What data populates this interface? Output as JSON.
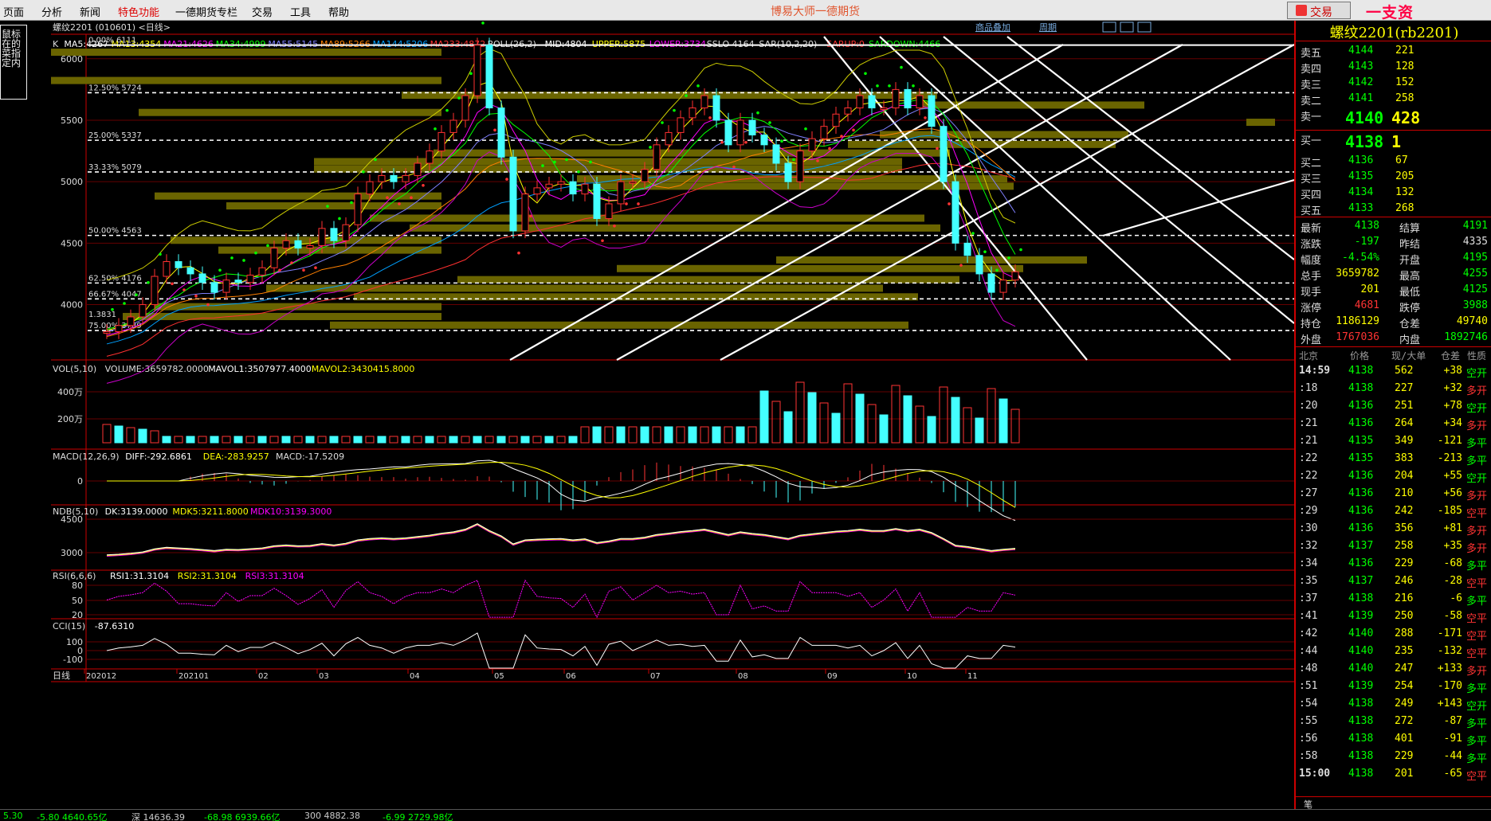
{
  "menu": {
    "items": [
      "页面",
      "分析",
      "新闻",
      "特色功能",
      "一德期货专栏",
      "交易",
      "工具",
      "帮助"
    ],
    "hot_index": 3,
    "app_title": "博易大师一德期货",
    "trade_label": "交易",
    "site_mark": "一支资5etz.com"
  },
  "tip_text": "鼠标在的菜指定内",
  "chart": {
    "header": "螺纹2201 (010601) <日线>",
    "toolbar_links": [
      "商品叠加",
      "周期"
    ],
    "main_legend": [
      {
        "text": "K",
        "color": "#dddddd"
      },
      {
        "text": "MA5:4267",
        "color": "#ffffff"
      },
      {
        "text": "MA13:4354",
        "color": "#ffff00"
      },
      {
        "text": "MA21:4626",
        "color": "#ff00ff"
      },
      {
        "text": "MA34:4999",
        "color": "#00ff00"
      },
      {
        "text": "MA55:5145",
        "color": "#8080ff"
      },
      {
        "text": "MA89:5266",
        "color": "#ff8000"
      },
      {
        "text": "MA144:5206",
        "color": "#00a0ff"
      },
      {
        "text": "MA233:4872",
        "color": "#ff3030"
      },
      {
        "text": "BOLL(26,2)",
        "color": "#dddddd"
      },
      {
        "text": "MID:4804",
        "color": "#ffffff"
      },
      {
        "text": "UPPER:5875",
        "color": "#ffff00"
      },
      {
        "text": "LOWER:3734",
        "color": "#ff00ff"
      },
      {
        "text": "SSLO 4164",
        "color": "#dddddd"
      },
      {
        "text": "SAR(10,2,20)",
        "color": "#dddddd"
      },
      {
        "text": "SARUP:0",
        "color": "#ff3030"
      },
      {
        "text": "SARDOWN:4466",
        "color": "#00ff00"
      }
    ],
    "price_ticks": [
      "6000",
      "5500",
      "5000",
      "4500",
      "4000"
    ],
    "fib_labels": [
      "0.00%  6111",
      "12.50%  5724",
      "25.00%  5337",
      "33.33%  5079",
      "50.00%  4563",
      "62.50%  4176",
      "66.67%  4047",
      "1.3831",
      "75.00%  3789"
    ],
    "vol_legend": [
      {
        "text": "VOL(5,10)",
        "color": "#dddddd"
      },
      {
        "text": "VOLUME:3659782.0000",
        "color": "#dddddd"
      },
      {
        "text": "MAVOL1:3507977.4000",
        "color": "#ffffff"
      },
      {
        "text": "MAVOL2:3430415.8000",
        "color": "#ffff00"
      }
    ],
    "vol_ticks": [
      "400万",
      "200万"
    ],
    "macd_legend": [
      {
        "text": "MACD(12,26,9)",
        "color": "#dddddd"
      },
      {
        "text": "DIFF:-292.6861",
        "color": "#ffffff"
      },
      {
        "text": "DEA:-283.9257",
        "color": "#ffff00"
      },
      {
        "text": "MACD:-17.5209",
        "color": "#dddddd"
      }
    ],
    "macd_ticks": [
      "0"
    ],
    "ndb_legend": [
      {
        "text": "NDB(5,10)",
        "color": "#dddddd"
      },
      {
        "text": "DK:3139.0000",
        "color": "#ffffff"
      },
      {
        "text": "MDK5:3211.8000",
        "color": "#ffff00"
      },
      {
        "text": "MDK10:3139.3000",
        "color": "#ff00ff"
      }
    ],
    "ndb_ticks": [
      "4500",
      "3000"
    ],
    "rsi_legend": [
      {
        "text": "RSI(6,6,6)",
        "color": "#dddddd"
      },
      {
        "text": "RSI1:31.3104",
        "color": "#ffffff"
      },
      {
        "text": "RSI2:31.3104",
        "color": "#ffff00"
      },
      {
        "text": "RSI3:31.3104",
        "color": "#ff00ff"
      }
    ],
    "rsi_ticks": [
      "80",
      "50",
      "20"
    ],
    "cci_legend": [
      {
        "text": "CCI(15)",
        "color": "#dddddd"
      },
      {
        "text": "-87.6310",
        "color": "#ffffff"
      }
    ],
    "cci_ticks": [
      "100",
      "0",
      "-100"
    ],
    "date_axis_label": "日线",
    "date_labels": [
      "202012",
      "202101",
      "02",
      "03",
      "04",
      "05",
      "06",
      "07",
      "08",
      "09",
      "10",
      "11"
    ]
  },
  "chart_data": {
    "type": "candlestick",
    "instrument": "螺纹2201 (rb2201)",
    "period": "日线",
    "x": [
      "202012",
      "202101",
      "02",
      "03",
      "04",
      "05",
      "06",
      "07",
      "08",
      "09",
      "10",
      "11"
    ],
    "price_axis_ticks": [
      4000,
      4500,
      5000,
      5500,
      6000
    ],
    "series": [
      {
        "name": "MA5",
        "last": 4267
      },
      {
        "name": "MA13",
        "last": 4354
      },
      {
        "name": "MA21",
        "last": 4626
      },
      {
        "name": "MA34",
        "last": 4999
      },
      {
        "name": "MA55",
        "last": 5145
      },
      {
        "name": "MA89",
        "last": 5266
      },
      {
        "name": "MA144",
        "last": 5206
      },
      {
        "name": "MA233",
        "last": 4872
      },
      {
        "name": "MID",
        "last": 4804
      },
      {
        "name": "UPPER",
        "last": 5875
      },
      {
        "name": "LOWER",
        "last": 3734
      },
      {
        "name": "SARDOWN",
        "last": 4466
      },
      {
        "name": "VOLUME",
        "last": 3659782
      },
      {
        "name": "MAVOL1",
        "last": 3507977.4
      },
      {
        "name": "MAVOL2",
        "last": 3430415.8
      },
      {
        "name": "DIFF",
        "last": -292.6861
      },
      {
        "name": "DEA",
        "last": -283.9257
      },
      {
        "name": "MACD",
        "last": -17.5209
      },
      {
        "name": "DK",
        "last": 3139
      },
      {
        "name": "MDK5",
        "last": 3211.8
      },
      {
        "name": "MDK10",
        "last": 3139.3
      },
      {
        "name": "RSI1",
        "last": 31.3104
      },
      {
        "name": "CCI",
        "last": -87.631
      }
    ],
    "fibonacci_levels": [
      {
        "pct": "0.00%",
        "price": 6111
      },
      {
        "pct": "12.50%",
        "price": 5724
      },
      {
        "pct": "25.00%",
        "price": 5337
      },
      {
        "pct": "33.33%",
        "price": 5079
      },
      {
        "pct": "50.00%",
        "price": 4563
      },
      {
        "pct": "62.50%",
        "price": 4176
      },
      {
        "pct": "66.67%",
        "price": 4047
      },
      {
        "pct": "75.00%",
        "price": 3789
      }
    ],
    "close_path": [
      3780,
      3830,
      3900,
      4000,
      4230,
      4350,
      4300,
      4250,
      4180,
      4100,
      4200,
      4180,
      4240,
      4300,
      4460,
      4520,
      4460,
      4480,
      4620,
      4520,
      4650,
      4900,
      5000,
      5050,
      5000,
      5050,
      5150,
      5250,
      5400,
      5500,
      5700,
      6111,
      5600,
      5200,
      4600,
      4900,
      4950,
      4980,
      5000,
      4900,
      4980,
      4700,
      4820,
      5000,
      5000,
      5100,
      5300,
      5400,
      5520,
      5600,
      5700,
      5500,
      5300,
      5500,
      5380,
      5300,
      5150,
      5000,
      5250,
      5350,
      5450,
      5550,
      5600,
      5700,
      5600,
      5600,
      5750,
      5600,
      5700,
      5450,
      5000,
      4500,
      4400,
      4250,
      4100,
      4200,
      4267
    ]
  },
  "right_panel": {
    "contract": "螺纹2201(rb2201)",
    "asks": [
      {
        "label": "卖五",
        "price": "4144",
        "vol": "221"
      },
      {
        "label": "卖四",
        "price": "4143",
        "vol": "128"
      },
      {
        "label": "卖三",
        "price": "4142",
        "vol": "152"
      },
      {
        "label": "卖二",
        "price": "4141",
        "vol": "258"
      },
      {
        "label": "卖一",
        "price": "4140",
        "vol": "428"
      }
    ],
    "bids": [
      {
        "label": "买一",
        "price": "4138",
        "vol": "1"
      },
      {
        "label": "买二",
        "price": "4136",
        "vol": "67"
      },
      {
        "label": "买三",
        "price": "4135",
        "vol": "205"
      },
      {
        "label": "买四",
        "price": "4134",
        "vol": "132"
      },
      {
        "label": "买五",
        "price": "4133",
        "vol": "268"
      }
    ],
    "stats": [
      {
        "l1": "最新",
        "v1": "4138",
        "c1": "g",
        "l2": "结算",
        "v2": "4191",
        "c2": "g"
      },
      {
        "l1": "涨跌",
        "v1": "-197",
        "c1": "g",
        "l2": "昨结",
        "v2": "4335",
        "c2": "w"
      },
      {
        "l1": "幅度",
        "v1": "-4.54%",
        "c1": "g",
        "l2": "开盘",
        "v2": "4195",
        "c2": "g"
      },
      {
        "l1": "总手",
        "v1": "3659782",
        "c1": "y",
        "l2": "最高",
        "v2": "4255",
        "c2": "g"
      },
      {
        "l1": "现手",
        "v1": "201",
        "c1": "y",
        "l2": "最低",
        "v2": "4125",
        "c2": "g"
      },
      {
        "l1": "涨停",
        "v1": "4681",
        "c1": "r",
        "l2": "跌停",
        "v2": "3988",
        "c2": "g"
      },
      {
        "l1": "持仓",
        "v1": "1186129",
        "c1": "y",
        "l2": "仓差",
        "v2": "49740",
        "c2": "y"
      },
      {
        "l1": "外盘",
        "v1": "1767036",
        "c1": "r",
        "l2": "内盘",
        "v2": "1892746",
        "c2": "g"
      }
    ],
    "ticks_header": [
      "北京",
      "价格",
      "现/大单",
      "仓差",
      "性质"
    ],
    "ticks": [
      {
        "t": "14:59",
        "p": "4138",
        "v": "562",
        "d": "+38",
        "n": "空开",
        "nc": "g"
      },
      {
        "t": ":18",
        "p": "4138",
        "v": "227",
        "d": "+32",
        "n": "多开",
        "nc": "r"
      },
      {
        "t": ":20",
        "p": "4136",
        "v": "251",
        "d": "+78",
        "n": "空开",
        "nc": "g"
      },
      {
        "t": ":21",
        "p": "4136",
        "v": "264",
        "d": "+34",
        "n": "多开",
        "nc": "r"
      },
      {
        "t": ":21",
        "p": "4135",
        "v": "349",
        "d": "-121",
        "n": "多平",
        "nc": "g"
      },
      {
        "t": ":22",
        "p": "4135",
        "v": "383",
        "d": "-213",
        "n": "多平",
        "nc": "g"
      },
      {
        "t": ":22",
        "p": "4136",
        "v": "204",
        "d": "+55",
        "n": "空开",
        "nc": "g"
      },
      {
        "t": ":27",
        "p": "4136",
        "v": "210",
        "d": "+56",
        "n": "多开",
        "nc": "r"
      },
      {
        "t": ":29",
        "p": "4136",
        "v": "242",
        "d": "-185",
        "n": "空平",
        "nc": "r"
      },
      {
        "t": ":30",
        "p": "4136",
        "v": "356",
        "d": "+81",
        "n": "多开",
        "nc": "r"
      },
      {
        "t": ":32",
        "p": "4137",
        "v": "258",
        "d": "+35",
        "n": "多开",
        "nc": "r"
      },
      {
        "t": ":34",
        "p": "4136",
        "v": "229",
        "d": "-68",
        "n": "多平",
        "nc": "g"
      },
      {
        "t": ":35",
        "p": "4137",
        "v": "246",
        "d": "-28",
        "n": "空平",
        "nc": "r"
      },
      {
        "t": ":37",
        "p": "4138",
        "v": "216",
        "d": "-6",
        "n": "多平",
        "nc": "g"
      },
      {
        "t": ":41",
        "p": "4139",
        "v": "250",
        "d": "-58",
        "n": "空平",
        "nc": "r"
      },
      {
        "t": ":42",
        "p": "4140",
        "v": "288",
        "d": "-171",
        "n": "空平",
        "nc": "r"
      },
      {
        "t": ":44",
        "p": "4140",
        "v": "235",
        "d": "-132",
        "n": "空平",
        "nc": "r"
      },
      {
        "t": ":48",
        "p": "4140",
        "v": "247",
        "d": "+133",
        "n": "多开",
        "nc": "r"
      },
      {
        "t": ":51",
        "p": "4139",
        "v": "254",
        "d": "-170",
        "n": "多平",
        "nc": "g"
      },
      {
        "t": ":54",
        "p": "4138",
        "v": "249",
        "d": "+143",
        "n": "空开",
        "nc": "g"
      },
      {
        "t": ":55",
        "p": "4138",
        "v": "272",
        "d": "-87",
        "n": "多平",
        "nc": "g"
      },
      {
        "t": ":56",
        "p": "4138",
        "v": "401",
        "d": "-91",
        "n": "多平",
        "nc": "g"
      },
      {
        "t": ":58",
        "p": "4138",
        "v": "229",
        "d": "-44",
        "n": "多平",
        "nc": "g"
      },
      {
        "t": "15:00",
        "p": "4138",
        "v": "201",
        "d": "-65",
        "n": "空平",
        "nc": "r"
      }
    ],
    "footer_tab": "笔"
  },
  "bottom_bar": {
    "items": [
      {
        "text": "5.30",
        "color": "#0f0"
      },
      {
        "text": "-5.80  4640.65亿",
        "color": "#0f0"
      },
      {
        "text": "深  14636.39",
        "color": "#ccc"
      },
      {
        "text": "-68.98  6939.66亿",
        "color": "#0f0"
      },
      {
        "text": "300  4882.38",
        "color": "#ccc"
      },
      {
        "text": "-6.99  2729.98亿",
        "color": "#0f0"
      }
    ]
  }
}
